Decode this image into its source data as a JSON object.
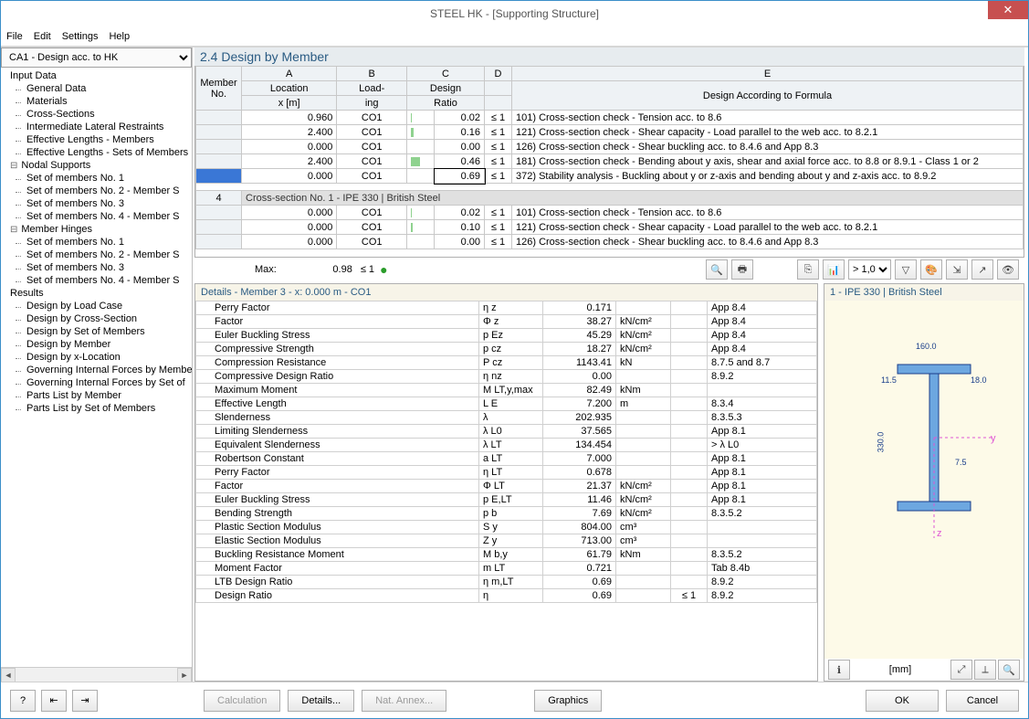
{
  "window": {
    "title": "STEEL HK - [Supporting Structure]"
  },
  "menu": [
    "File",
    "Edit",
    "Settings",
    "Help"
  ],
  "combo": "CA1 - Design acc. to HK",
  "tree": [
    {
      "t": "root",
      "l": "Input Data"
    },
    {
      "t": "child",
      "l": "General Data"
    },
    {
      "t": "child",
      "l": "Materials"
    },
    {
      "t": "child",
      "l": "Cross-Sections"
    },
    {
      "t": "child",
      "l": "Intermediate Lateral Restraints"
    },
    {
      "t": "child",
      "l": "Effective Lengths - Members"
    },
    {
      "t": "child",
      "l": "Effective Lengths - Sets of Members"
    },
    {
      "t": "parent",
      "l": "Nodal Supports"
    },
    {
      "t": "child",
      "l": "Set of members No. 1"
    },
    {
      "t": "child",
      "l": "Set of members No. 2 - Member S"
    },
    {
      "t": "child",
      "l": "Set of members No. 3"
    },
    {
      "t": "child",
      "l": "Set of members No. 4 - Member S"
    },
    {
      "t": "parent",
      "l": "Member Hinges"
    },
    {
      "t": "child",
      "l": "Set of members No. 1"
    },
    {
      "t": "child",
      "l": "Set of members No. 2 - Member S"
    },
    {
      "t": "child",
      "l": "Set of members No. 3"
    },
    {
      "t": "child",
      "l": "Set of members No. 4 - Member S"
    },
    {
      "t": "root",
      "l": "Results"
    },
    {
      "t": "child",
      "l": "Design by Load Case"
    },
    {
      "t": "child",
      "l": "Design by Cross-Section"
    },
    {
      "t": "child",
      "l": "Design by Set of Members"
    },
    {
      "t": "child",
      "l": "Design by Member"
    },
    {
      "t": "child",
      "l": "Design by x-Location"
    },
    {
      "t": "child",
      "l": "Governing Internal Forces by Membe"
    },
    {
      "t": "child",
      "l": "Governing Internal Forces by Set of"
    },
    {
      "t": "child",
      "l": "Parts List by Member"
    },
    {
      "t": "child",
      "l": "Parts List by Set of Members"
    }
  ],
  "sectionTitle": "2.4 Design by Member",
  "gridHdr": {
    "cols": [
      "A",
      "B",
      "C",
      "D",
      "E"
    ],
    "member": "Member",
    "no": "No.",
    "loc1": "Location",
    "loc2": "x [m]",
    "load1": "Load-",
    "load2": "ing",
    "design1": "Design",
    "design2": "Ratio",
    "formula": "Design According to Formula"
  },
  "gridRows": [
    {
      "x": "0.960",
      "ld": "CO1",
      "ratio": "0.02",
      "le": "≤ 1",
      "desc": "101) Cross-section check - Tension acc. to 8.6",
      "bar": 2,
      "color": "#8fd28f"
    },
    {
      "x": "2.400",
      "ld": "CO1",
      "ratio": "0.16",
      "le": "≤ 1",
      "desc": "121) Cross-section check - Shear capacity - Load parallel to the web acc. to 8.2.1",
      "bar": 16,
      "color": "#8fd28f"
    },
    {
      "x": "0.000",
      "ld": "CO1",
      "ratio": "0.00",
      "le": "≤ 1",
      "desc": "126) Cross-section check - Shear buckling acc. to 8.4.6 and App 8.3",
      "bar": 0,
      "color": "#8fd28f"
    },
    {
      "x": "2.400",
      "ld": "CO1",
      "ratio": "0.46",
      "le": "≤ 1",
      "desc": "181) Cross-section check - Bending about y axis, shear and axial force acc. to 8.8 or  8.9.1 - Class 1 or 2",
      "bar": 46,
      "color": "#8fd28f"
    },
    {
      "x": "0.000",
      "ld": "CO1",
      "ratio": "0.69",
      "le": "≤ 1",
      "desc": "372) Stability analysis - Buckling about y or z-axis and bending about y and z-axis acc. to 8.9.2",
      "bar": 0,
      "color": "#8fd28f",
      "sel": true
    }
  ],
  "subGroup": {
    "no": "4",
    "label": "Cross-section No.  1 - IPE 330 | British Steel"
  },
  "gridRows2": [
    {
      "x": "0.000",
      "ld": "CO1",
      "ratio": "0.02",
      "le": "≤ 1",
      "desc": "101) Cross-section check - Tension acc. to 8.6",
      "bar": 2,
      "color": "#8fd28f"
    },
    {
      "x": "0.000",
      "ld": "CO1",
      "ratio": "0.10",
      "le": "≤ 1",
      "desc": "121) Cross-section check - Shear capacity - Load parallel to the web acc. to 8.2.1",
      "bar": 10,
      "color": "#8fd28f"
    },
    {
      "x": "0.000",
      "ld": "CO1",
      "ratio": "0.00",
      "le": "≤ 1",
      "desc": "126) Cross-section check - Shear buckling acc. to 8.4.6 and App 8.3",
      "bar": 0,
      "color": "#8fd28f"
    }
  ],
  "maxLabel": "Max:",
  "maxValue": "0.98",
  "maxLE": "≤ 1",
  "scaleCombo": "> 1,0",
  "detailsTitle": "Details - Member 3 - x: 0.000 m - CO1",
  "details": [
    {
      "n": "Perry Factor",
      "s": "η z",
      "v": "0.171",
      "u": "",
      "r": "App 8.4"
    },
    {
      "n": "Factor",
      "s": "Φ z",
      "v": "38.27",
      "u": "kN/cm²",
      "r": "App 8.4"
    },
    {
      "n": "Euler Buckling Stress",
      "s": "p Ez",
      "v": "45.29",
      "u": "kN/cm²",
      "r": "App 8.4"
    },
    {
      "n": "Compressive Strength",
      "s": "p cz",
      "v": "18.27",
      "u": "kN/cm²",
      "r": "App 8.4"
    },
    {
      "n": "Compression Resistance",
      "s": "P cz",
      "v": "1143.41",
      "u": "kN",
      "r": "8.7.5 and 8.7"
    },
    {
      "n": "Compressive Design Ratio",
      "s": "η nz",
      "v": "0.00",
      "u": "",
      "r": "8.9.2"
    },
    {
      "n": "Maximum Moment",
      "s": "M LT,y,max",
      "v": "82.49",
      "u": "kNm",
      "r": ""
    },
    {
      "n": "Effective Length",
      "s": "L E",
      "v": "7.200",
      "u": "m",
      "r": "8.3.4"
    },
    {
      "n": "Slenderness",
      "s": "λ",
      "v": "202.935",
      "u": "",
      "r": "8.3.5.3"
    },
    {
      "n": "Limiting Slenderness",
      "s": "λ L0",
      "v": "37.565",
      "u": "",
      "r": "App 8.1"
    },
    {
      "n": "Equivalent Slenderness",
      "s": "λ LT",
      "v": "134.454",
      "u": "",
      "r": "> λ L0"
    },
    {
      "n": "Robertson Constant",
      "s": "a LT",
      "v": "7.000",
      "u": "",
      "r": "App 8.1"
    },
    {
      "n": "Perry Factor",
      "s": "η LT",
      "v": "0.678",
      "u": "",
      "r": "App 8.1"
    },
    {
      "n": "Factor",
      "s": "Φ LT",
      "v": "21.37",
      "u": "kN/cm²",
      "r": "App 8.1"
    },
    {
      "n": "Euler Buckling Stress",
      "s": "p E,LT",
      "v": "11.46",
      "u": "kN/cm²",
      "r": "App 8.1"
    },
    {
      "n": "Bending Strength",
      "s": "p b",
      "v": "7.69",
      "u": "kN/cm²",
      "r": "8.3.5.2"
    },
    {
      "n": "Plastic Section Modulus",
      "s": "S y",
      "v": "804.00",
      "u": "cm³",
      "r": ""
    },
    {
      "n": "Elastic Section Modulus",
      "s": "Z y",
      "v": "713.00",
      "u": "cm³",
      "r": ""
    },
    {
      "n": "Buckling Resistance Moment",
      "s": "M b,y",
      "v": "61.79",
      "u": "kNm",
      "r": "8.3.5.2"
    },
    {
      "n": "Moment Factor",
      "s": "m LT",
      "v": "0.721",
      "u": "",
      "r": "Tab 8.4b"
    },
    {
      "n": "LTB Design Ratio",
      "s": "η m,LT",
      "v": "0.69",
      "u": "",
      "r": "8.9.2"
    },
    {
      "n": "Design Ratio",
      "s": "η",
      "v": "0.69",
      "u": "",
      "r": "8.9.2",
      "le": "≤ 1"
    }
  ],
  "sectionPanel": {
    "title": "1 - IPE 330 | British Steel",
    "unit": "[mm]",
    "dims": {
      "w": "160.0",
      "h": "330.0",
      "tf": "11.5",
      "tw": "7.5",
      "br": "18.0"
    }
  },
  "buttons": {
    "calc": "Calculation",
    "details": "Details...",
    "nat": "Nat. Annex...",
    "graphics": "Graphics",
    "ok": "OK",
    "cancel": "Cancel"
  }
}
